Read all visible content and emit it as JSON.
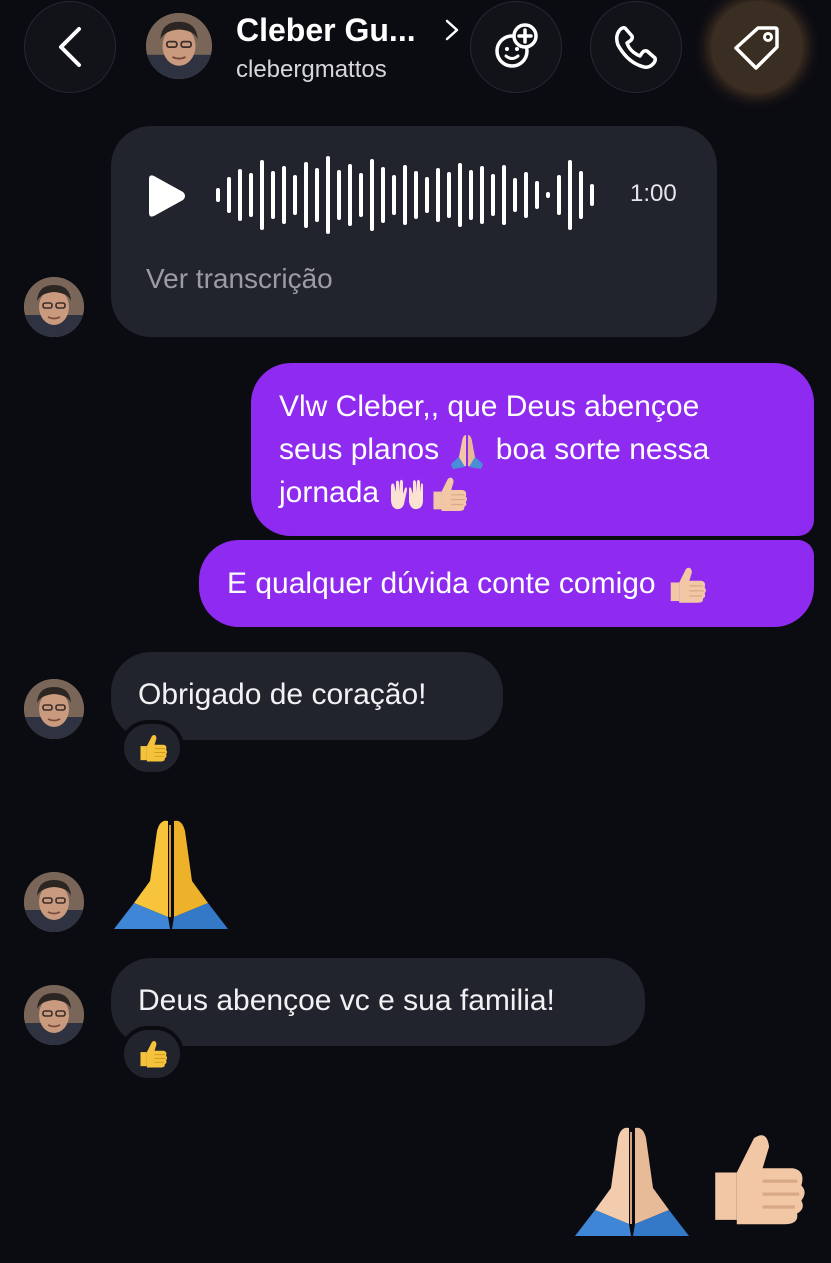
{
  "header": {
    "contact_name": "Cleber Gu...",
    "contact_handle": "clebergmattos",
    "icons": [
      "back-chevron-icon",
      "effects-icon",
      "phone-icon",
      "tag-icon"
    ]
  },
  "messages": {
    "voice": {
      "duration": "1:00",
      "transcript_label": "Ver transcrição"
    },
    "sent_1": {
      "line1": "Vlw Cleber,, que Deus abençoe",
      "line2_before": "seus planos ",
      "line2_after": " boa sorte nessa",
      "line3": "jornada "
    },
    "sent_2": {
      "text": "E qualquer dúvida conte comigo "
    },
    "received_1": {
      "text": "Obrigado de coração!",
      "reaction": "thumbs-up"
    },
    "received_2": {
      "text": "Deus abençoe vc e sua familia!",
      "reaction": "thumbs-up"
    },
    "emoji_messages": [
      "folded-hands",
      "folded-hands",
      "thumbs-up"
    ]
  },
  "colors": {
    "background": "#0b0c12",
    "received_bubble": "#22242d",
    "sent_bubble": "#8f2bf0"
  }
}
